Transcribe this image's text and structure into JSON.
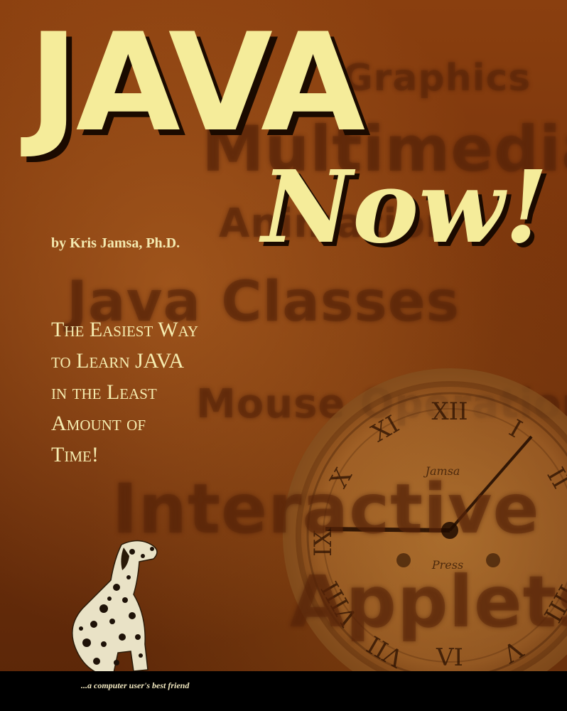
{
  "cover": {
    "title_main": "JAVA",
    "title_sub": "Now!",
    "author": "by Kris Jamsa, Ph.D.",
    "tagline": [
      "The Easiest Way",
      "to Learn JAVA",
      "in the Least",
      "Amount of",
      "Time!"
    ],
    "background_words": {
      "graphics": "Graphics",
      "multimedia": "Multimedia",
      "animation": "Animation",
      "classes": "Java Classes",
      "mouse": "Mouse Operations",
      "interactive": "Interactive",
      "applets": "Applets"
    },
    "clock": {
      "brand_top": "Jamsa",
      "brand_bottom": "Press"
    },
    "footer_text": "...a computer user's best friend",
    "colors": {
      "title": "#f5ec9a",
      "background": "#7a350c",
      "text": "#f5ecb0"
    }
  }
}
